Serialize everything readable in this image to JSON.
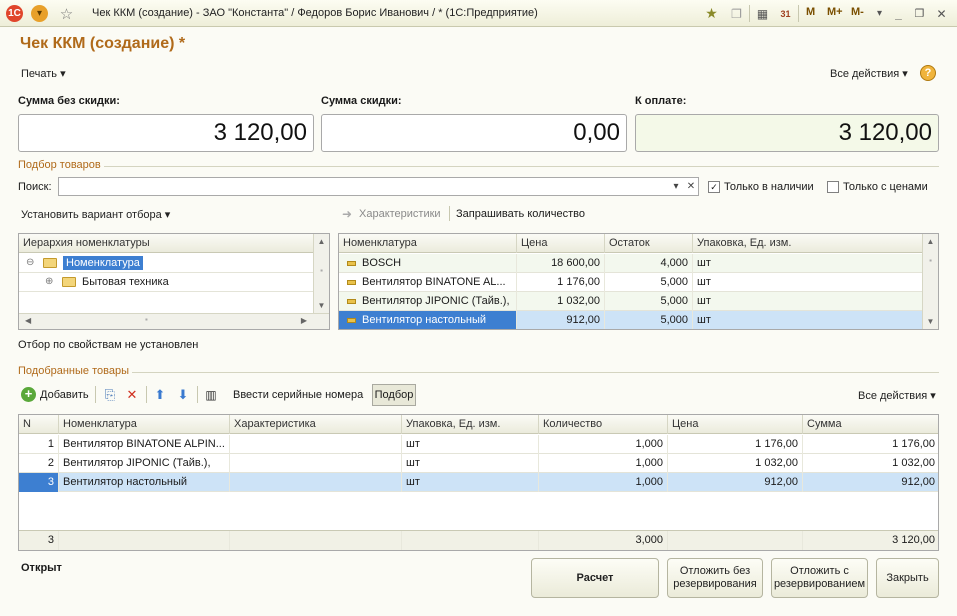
{
  "window": {
    "title": "Чек ККМ (создание) - ЗАО \"Константа\" / Федоров Борис Иванович / * (1С:Предприятие)",
    "right_buttons": [
      "M",
      "M+",
      "M-"
    ]
  },
  "form": {
    "title": "Чек ККМ (создание) *",
    "print_label": "Печать",
    "all_actions_label": "Все действия",
    "help": "?"
  },
  "sums": {
    "without_discount_label": "Сумма без скидки:",
    "without_discount_value": "3 120,00",
    "discount_label": "Сумма скидки:",
    "discount_value": "0,00",
    "to_pay_label": "К оплате:",
    "to_pay_value": "3 120,00"
  },
  "selection": {
    "section_title": "Подбор товаров",
    "search_label": "Поиск:",
    "search_value": "",
    "only_in_stock_label": "Только в наличии",
    "only_in_stock_checked": true,
    "only_with_prices_label": "Только с ценами",
    "only_with_prices_checked": false,
    "set_filter_label": "Установить вариант отбора",
    "characteristics_label": "Характеристики",
    "ask_quantity_label": "Запрашивать количество",
    "hierarchy": {
      "header": "Иерархия номенклатуры",
      "items": [
        {
          "label": "Номенклатура",
          "selected": true
        },
        {
          "label": "Бытовая техника",
          "selected": false
        }
      ]
    },
    "goods": {
      "columns": [
        "Номенклатура",
        "Цена",
        "Остаток",
        "Упаковка, Ед. изм."
      ],
      "rows": [
        {
          "name": "BOSCH",
          "price": "18 600,00",
          "stock": "4,000",
          "unit": "шт"
        },
        {
          "name": "Вентилятор BINATONE AL...",
          "price": "1 176,00",
          "stock": "5,000",
          "unit": "шт"
        },
        {
          "name": "Вентилятор JIPONIC (Тайв.),",
          "price": "1 032,00",
          "stock": "5,000",
          "unit": "шт"
        },
        {
          "name": "Вентилятор настольный",
          "price": "912,00",
          "stock": "5,000",
          "unit": "шт"
        }
      ]
    },
    "filter_status": "Отбор по свойствам не установлен"
  },
  "picked": {
    "section_title": "Подобранные товары",
    "add_label": "Добавить",
    "serial_label": "Ввести серийные номера",
    "pick_label": "Подбор",
    "all_actions_label": "Все действия",
    "columns": [
      "N",
      "Номенклатура",
      "Характеристика",
      "Упаковка, Ед. изм.",
      "Количество",
      "Цена",
      "Сумма"
    ],
    "rows": [
      {
        "n": "1",
        "name": "Вентилятор BINATONE ALPIN...",
        "char": "",
        "unit": "шт",
        "qty": "1,000",
        "price": "1 176,00",
        "sum": "1 176,00"
      },
      {
        "n": "2",
        "name": "Вентилятор JIPONIC (Тайв.),",
        "char": "",
        "unit": "шт",
        "qty": "1,000",
        "price": "1 032,00",
        "sum": "1 032,00"
      },
      {
        "n": "3",
        "name": "Вентилятор настольный",
        "char": "",
        "unit": "шт",
        "qty": "1,000",
        "price": "912,00",
        "sum": "912,00"
      }
    ],
    "footer": {
      "n": "3",
      "qty": "3,000",
      "sum": "3 120,00"
    }
  },
  "bottom": {
    "status": "Открыт",
    "payment_label": "Расчет",
    "postpone_no_reserve_label": "Отложить без резервирования",
    "postpone_reserve_label": "Отложить с резервированием",
    "close_label": "Закрыть"
  },
  "colors": {
    "accent": "#b06a1a",
    "selection": "#3d7fd1",
    "row_highlight": "#cde3f7"
  }
}
